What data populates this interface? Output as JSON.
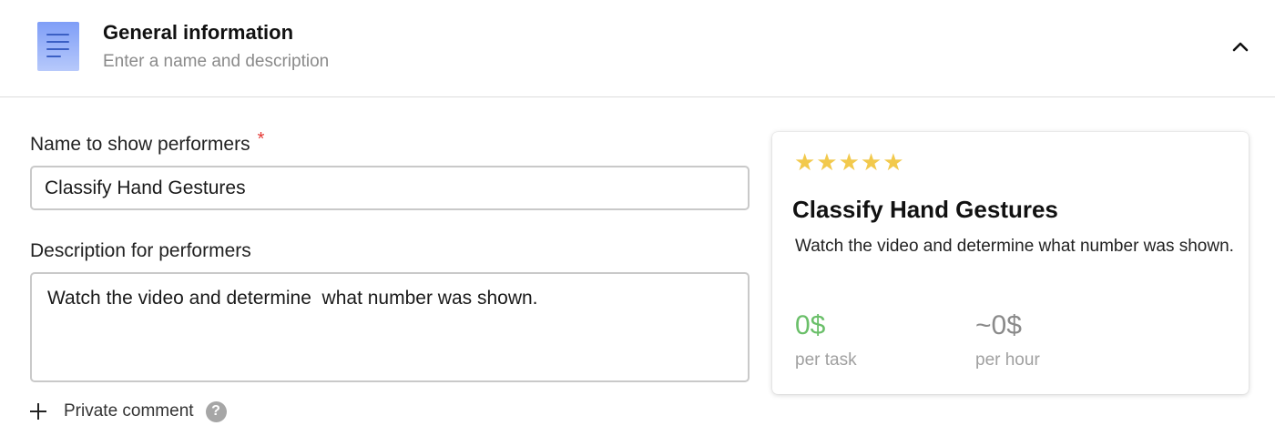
{
  "header": {
    "title": "General information",
    "subtitle": "Enter a name and description"
  },
  "form": {
    "name_label": "Name to show performers",
    "required_mark": "*",
    "name_value": "Classify Hand Gestures",
    "description_label": "Description for performers",
    "description_value": "Watch the video and determine  what number was shown.",
    "private_comment_label": "Private comment",
    "help_glyph": "?"
  },
  "preview": {
    "stars": "★★★★★",
    "rating": 5,
    "title": "Classify Hand Gestures",
    "description": "Watch the video and determine what number was shown.",
    "price_per_task": "0$",
    "per_task_label": "per task",
    "price_per_hour": "~0$",
    "per_hour_label": "per hour"
  },
  "colors": {
    "accent_green": "#6abf69",
    "star_yellow": "#f2c94c",
    "required_red": "#e53935",
    "icon_blue": "#7f9ef7"
  }
}
